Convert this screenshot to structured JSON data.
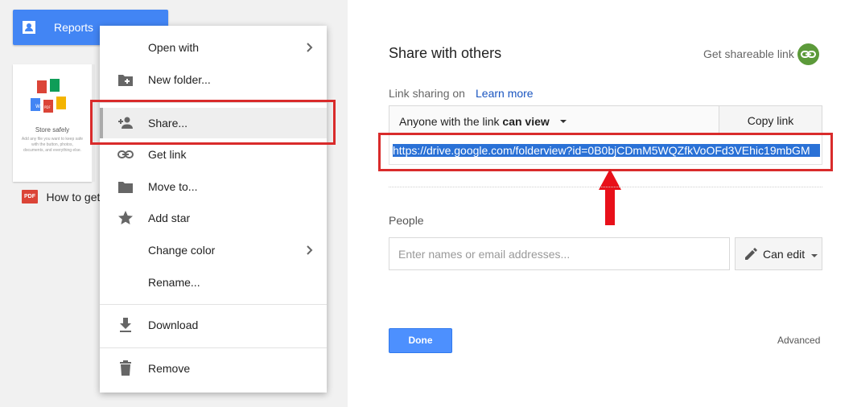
{
  "folder": {
    "label": "Reports",
    "color": "#4285f4",
    "icon": "shared-folder-icon"
  },
  "file_card": {
    "thumb_title": "Store safely",
    "thumb_text": "Add any file you want to keep safe with the  button, photos, documents, and everything else.",
    "file_name": "How to get",
    "file_type_badge": "PDF"
  },
  "context_menu": {
    "items": [
      {
        "label": "Open with",
        "icon": "",
        "has_submenu": true
      },
      {
        "label": "New folder...",
        "icon": "folder-add-icon"
      },
      {
        "label": "Share...",
        "icon": "person-add-icon",
        "active": true
      },
      {
        "label": "Get link",
        "icon": "link-icon"
      },
      {
        "label": "Move to...",
        "icon": "folder-icon"
      },
      {
        "label": "Add star",
        "icon": "star-icon"
      },
      {
        "label": "Change color",
        "icon": "",
        "has_submenu": true
      },
      {
        "label": "Rename...",
        "icon": ""
      },
      {
        "label": "Download",
        "icon": "download-icon"
      },
      {
        "label": "Remove",
        "icon": "trash-icon"
      }
    ]
  },
  "dialog": {
    "title": "Share with others",
    "get_shareable_link": "Get shareable link",
    "link_sharing_label": "Link sharing on",
    "learn_more": "Learn more",
    "access_prefix": "Anyone with the link",
    "access_level": "can view",
    "copy_link": "Copy link",
    "link_url": "https://drive.google.com/folderview?id=0B0bjCDmM5WQZfkVoOFd3VEhic19mbGM",
    "people_label": "People",
    "people_placeholder": "Enter names or email addresses...",
    "can_edit": "Can edit",
    "done": "Done",
    "advanced": "Advanced"
  },
  "colors": {
    "highlight_red": "#d92b2b",
    "accent_blue": "#4d90fe",
    "link_green": "#5c9a3a"
  }
}
